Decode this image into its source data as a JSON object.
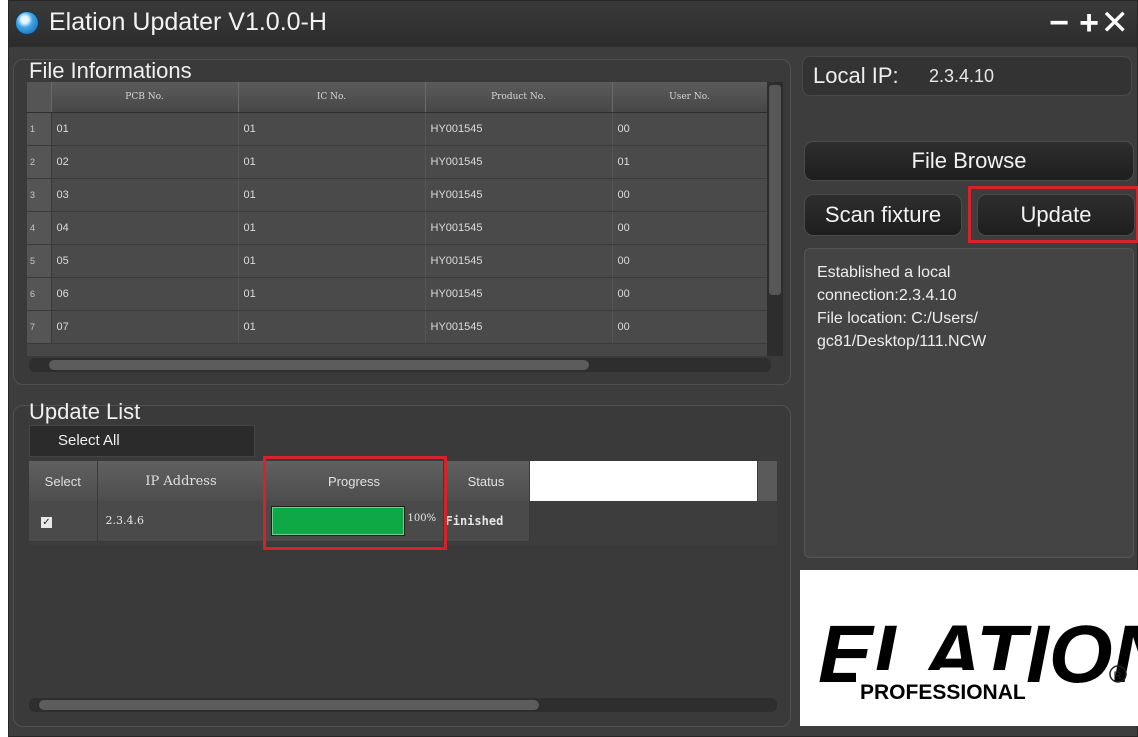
{
  "window": {
    "title": "Elation Updater V1.0.0-H",
    "controls": {
      "minimize": "−",
      "maximize": "+",
      "close": "✕"
    }
  },
  "file_info": {
    "title": "File Informations",
    "columns": [
      "PCB No.",
      "IC No.",
      "Product No.",
      "User No."
    ],
    "rows": [
      {
        "n": "1",
        "pcb": "01",
        "ic": "01",
        "product": "HY001545",
        "user": "00"
      },
      {
        "n": "2",
        "pcb": "02",
        "ic": "01",
        "product": "HY001545",
        "user": "01"
      },
      {
        "n": "3",
        "pcb": "03",
        "ic": "01",
        "product": "HY001545",
        "user": "00"
      },
      {
        "n": "4",
        "pcb": "04",
        "ic": "01",
        "product": "HY001545",
        "user": "00"
      },
      {
        "n": "5",
        "pcb": "05",
        "ic": "01",
        "product": "HY001545",
        "user": "00"
      },
      {
        "n": "6",
        "pcb": "06",
        "ic": "01",
        "product": "HY001545",
        "user": "00"
      },
      {
        "n": "7",
        "pcb": "07",
        "ic": "01",
        "product": "HY001545",
        "user": "00"
      }
    ]
  },
  "update_list": {
    "title": "Update List",
    "select_all": "Select All",
    "columns": {
      "select": "Select",
      "ip": "IP Address",
      "progress": "Progress",
      "status": "Status"
    },
    "rows": [
      {
        "checked": "✓",
        "ip": "2.3.4.6",
        "progress": 1.0,
        "progress_label": "100%",
        "status": "Finished"
      }
    ]
  },
  "side": {
    "local_ip_label": "Local IP:",
    "local_ip": "2.3.4.10",
    "file_browse": "File Browse",
    "scan_fixture": "Scan fixture",
    "update": "Update",
    "log": [
      "Established a local",
      "connection:2.3.4.10",
      "File location: C:/Users/",
      "gc81/Desktop/111.NCW"
    ]
  },
  "logo": {
    "brand": "ELATION",
    "tagline": "PROFESSIONAL"
  },
  "colors": {
    "highlight_red": "#d6232a",
    "progress_green": "#0fa846"
  }
}
